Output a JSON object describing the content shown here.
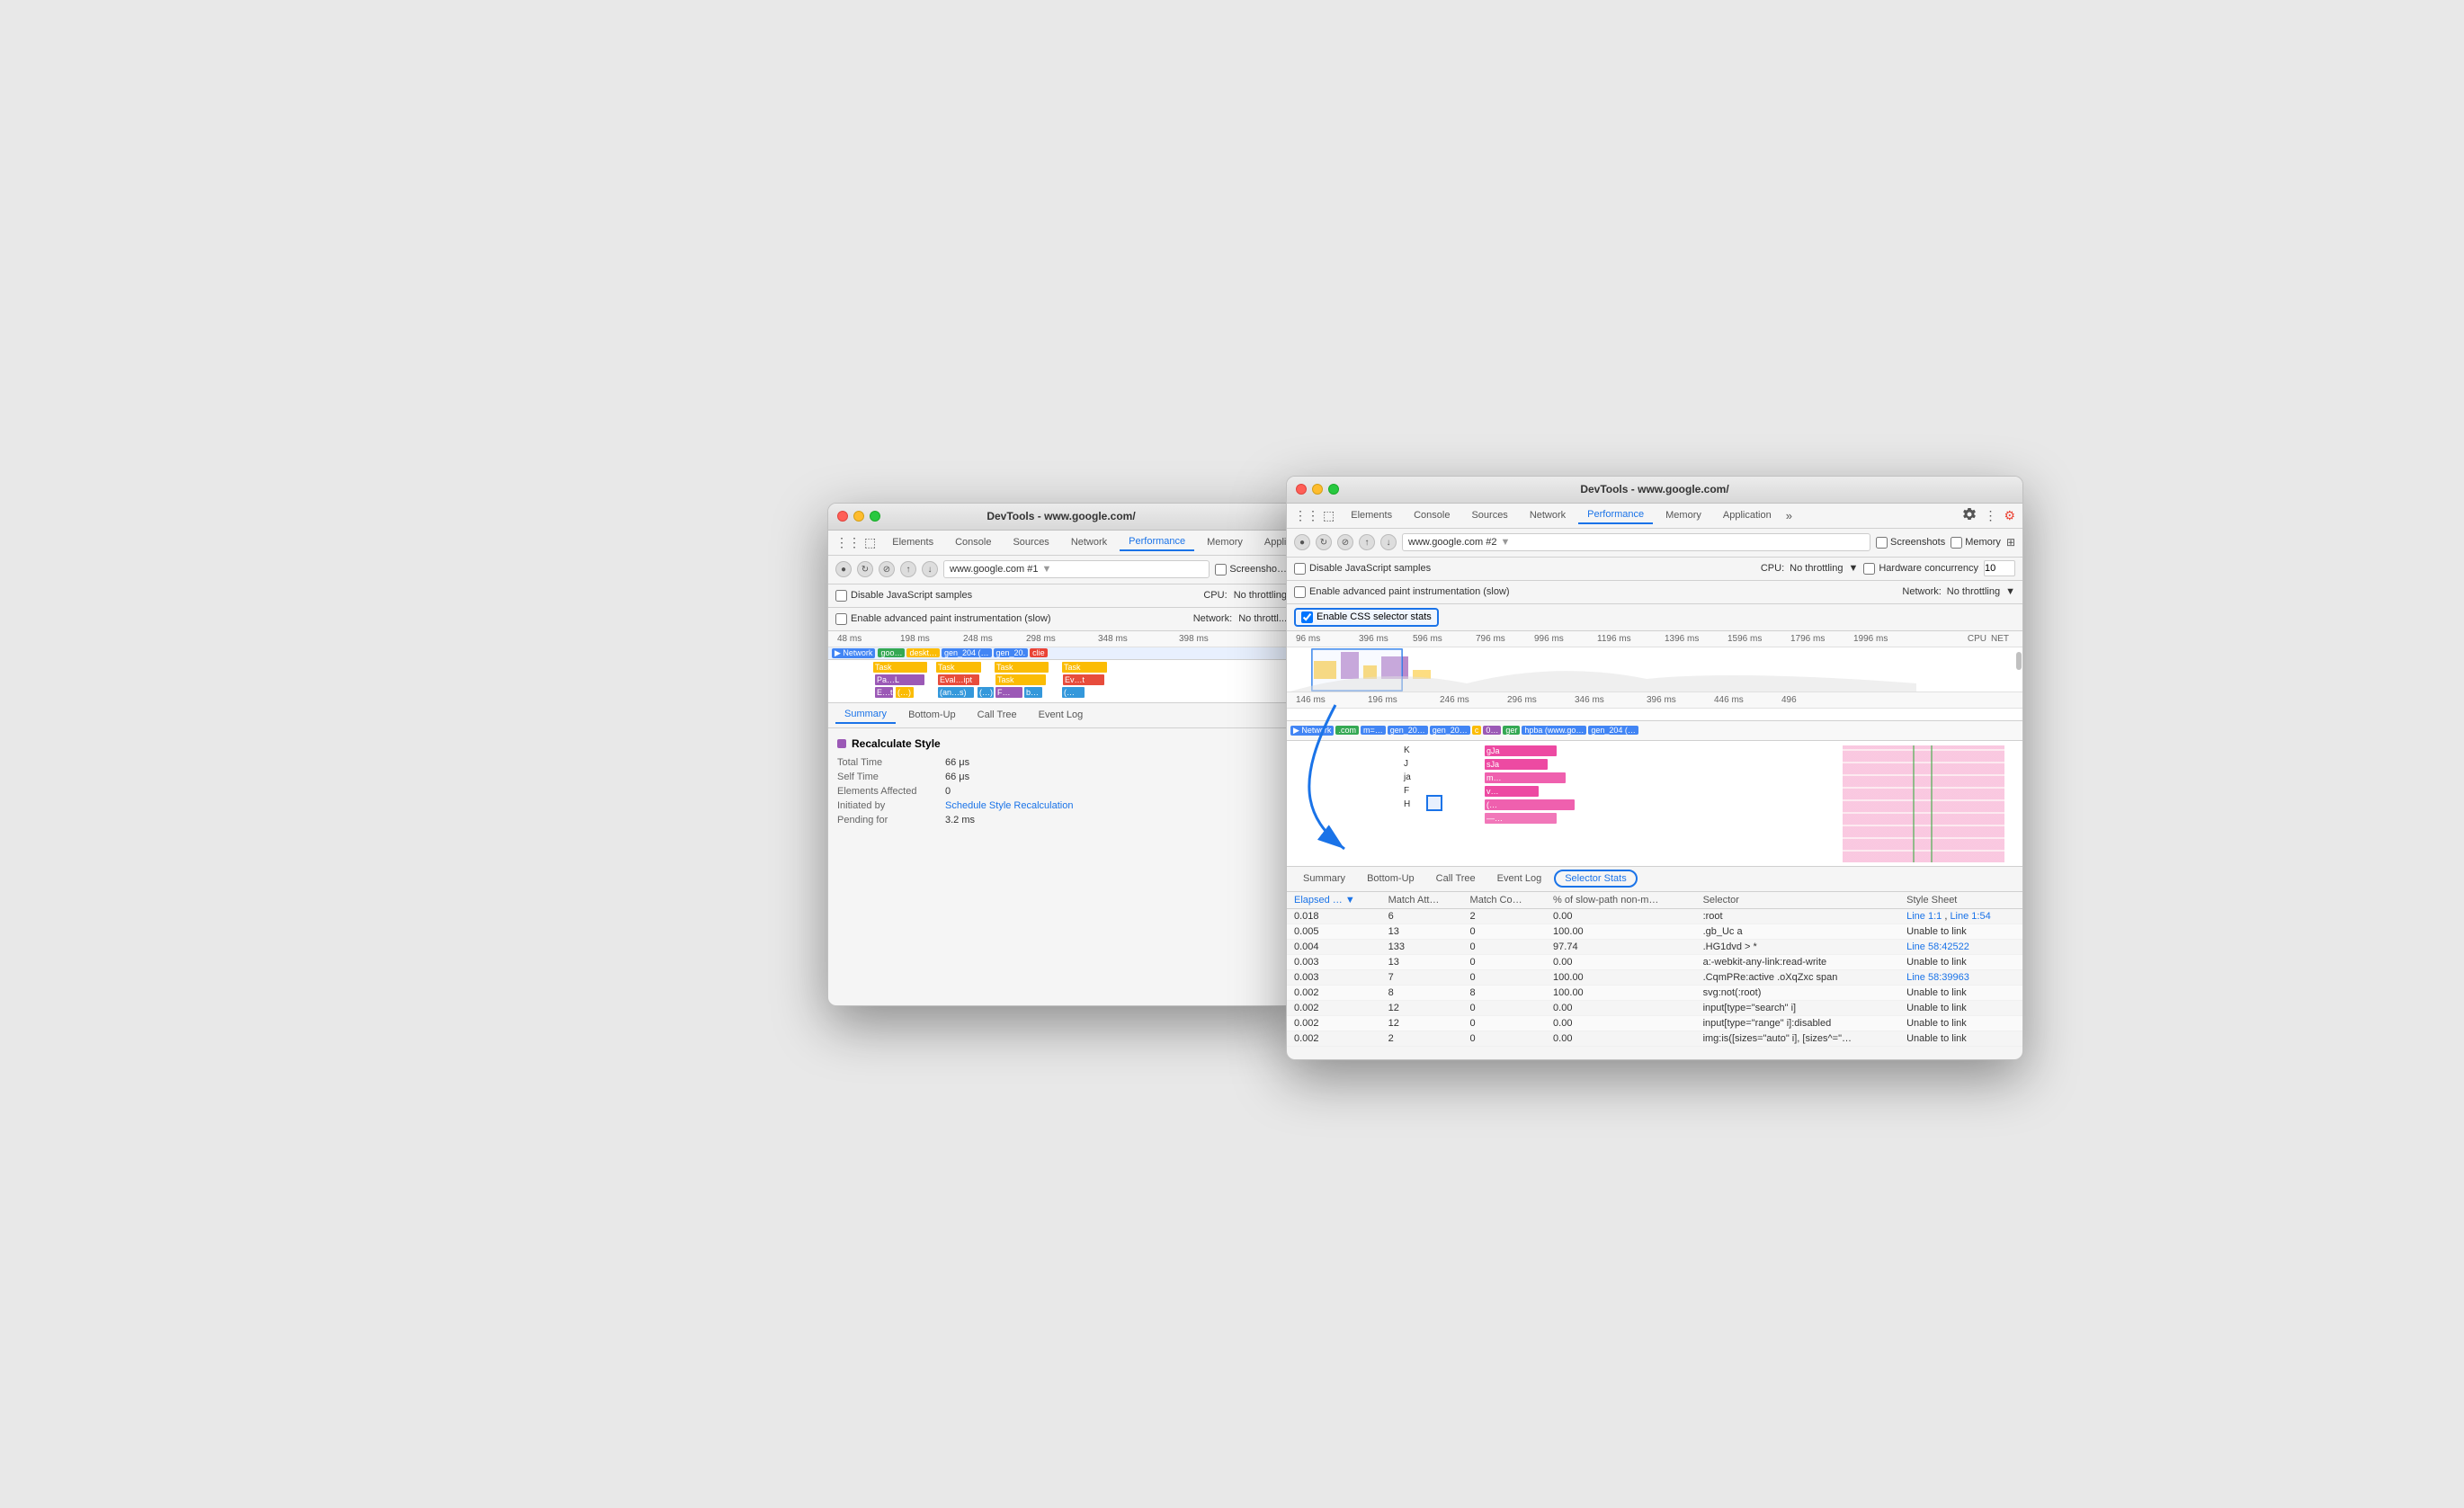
{
  "back_window": {
    "title": "DevTools - www.google.com/",
    "tabs": [
      "Elements",
      "Console",
      "Sources",
      "Network",
      "Performance",
      "Memory",
      "Application"
    ],
    "active_tab": "Performance",
    "address": "www.google.com #1",
    "options": {
      "disable_js_samples": "Disable JavaScript samples",
      "enable_advanced_paint": "Enable advanced paint instrumentation (slow)"
    },
    "cpu_label": "CPU:",
    "cpu_value": "No throttling",
    "network_label": "Network:",
    "network_value": "No throttl...",
    "bottom_tabs": [
      "Summary",
      "Bottom-Up",
      "Call Tree",
      "Event Log"
    ],
    "active_bottom_tab": "Summary",
    "summary": {
      "title": "Recalculate Style",
      "color": "#9b59b6",
      "rows": [
        {
          "label": "Total Time",
          "value": "66 μs"
        },
        {
          "label": "Self Time",
          "value": "66 μs"
        },
        {
          "label": "Elements Affected",
          "value": "0"
        },
        {
          "label": "Initiated by",
          "value": "Schedule Style Recalculation",
          "is_link": true
        },
        {
          "label": "Pending for",
          "value": "3.2 ms"
        }
      ]
    },
    "time_ticks": [
      "48 ms",
      "198 ms",
      "248 ms",
      "298 ms",
      "348 ms",
      "398 ms"
    ],
    "network_items": [
      "Network",
      "goo...",
      "deskt...",
      "gen_204 (…",
      "gen_20.",
      "clie"
    ]
  },
  "front_window": {
    "title": "DevTools - www.google.com/",
    "tabs": [
      "Elements",
      "Console",
      "Sources",
      "Network",
      "Performance",
      "Memory",
      "Application"
    ],
    "active_tab": "Performance",
    "address": "www.google.com #2",
    "screenshots_label": "Screenshots",
    "memory_label": "Memory",
    "options": {
      "disable_js_samples": "Disable JavaScript samples",
      "enable_advanced_paint": "Enable advanced paint instrumentation (slow)"
    },
    "cpu_label": "CPU:",
    "cpu_value": "No throttling",
    "hardware_concurrency_label": "Hardware concurrency",
    "hardware_concurrency_value": "10",
    "network_label": "Network:",
    "network_value": "No throttling",
    "css_selector_stats": "Enable CSS selector stats",
    "css_selector_checked": true,
    "time_ticks_front": [
      "96 ms",
      "396 ms",
      "596 ms",
      "796 ms",
      "996 ms",
      "1196 ms",
      "1396 ms",
      "1596 ms",
      "1796 ms",
      "1996 ms"
    ],
    "cpu_label_right": "CPU",
    "net_label_right": "NET",
    "time_ticks_bottom": [
      "146 ms",
      "196 ms",
      "246 ms",
      "296 ms",
      "346 ms",
      "396 ms",
      "446 ms",
      "496"
    ],
    "network_items": [
      "Network",
      ".com",
      "m=...",
      "gen_20...",
      "gen_20...",
      "c",
      "0...",
      "ger",
      "hpba (www.go...",
      "gen_204 (…"
    ],
    "bottom_tabs": [
      "Summary",
      "Bottom-Up",
      "Call Tree",
      "Event Log",
      "Selector Stats"
    ],
    "active_bottom_tab": "Selector Stats",
    "table": {
      "columns": [
        "Elapsed …",
        "Match Att…",
        "Match Co…",
        "% of slow-path non-m…",
        "Selector",
        "Style Sheet"
      ],
      "rows": [
        {
          "elapsed": "0.018",
          "match_att": "6",
          "match_co": "2",
          "slow_path": "0.00",
          "selector": ":root",
          "style_sheet": "Line 1:1 , Line 1:54"
        },
        {
          "elapsed": "0.005",
          "match_att": "13",
          "match_co": "0",
          "slow_path": "100.00",
          "selector": ".gb_Uc a",
          "style_sheet": "Unable to link"
        },
        {
          "elapsed": "0.004",
          "match_att": "133",
          "match_co": "0",
          "slow_path": "97.74",
          "selector": ".HG1dvd > *",
          "style_sheet": "Line 58:42522"
        },
        {
          "elapsed": "0.003",
          "match_att": "13",
          "match_co": "0",
          "slow_path": "0.00",
          "selector": "a:-webkit-any-link:read-write",
          "style_sheet": "Unable to link"
        },
        {
          "elapsed": "0.003",
          "match_att": "7",
          "match_co": "0",
          "slow_path": "100.00",
          "selector": ".CqmPRe:active .oXqZxc span",
          "style_sheet": "Line 58:39963"
        },
        {
          "elapsed": "0.002",
          "match_att": "8",
          "match_co": "8",
          "slow_path": "100.00",
          "selector": "svg:not(:root)",
          "style_sheet": "Unable to link"
        },
        {
          "elapsed": "0.002",
          "match_att": "12",
          "match_co": "0",
          "slow_path": "0.00",
          "selector": "input[type=\"search\" i]",
          "style_sheet": "Unable to link"
        },
        {
          "elapsed": "0.002",
          "match_att": "12",
          "match_co": "0",
          "slow_path": "0.00",
          "selector": "input[type=\"range\" i]:disabled",
          "style_sheet": "Unable to link"
        },
        {
          "elapsed": "0.002",
          "match_att": "2",
          "match_co": "0",
          "slow_path": "0.00",
          "selector": "img:is([sizes=\"auto\" i], [sizes^=\"…",
          "style_sheet": "Unable to link"
        }
      ]
    }
  },
  "arrow": {
    "description": "Blue arrow pointing from css-selector-stats checkbox to Selector Stats tab"
  }
}
